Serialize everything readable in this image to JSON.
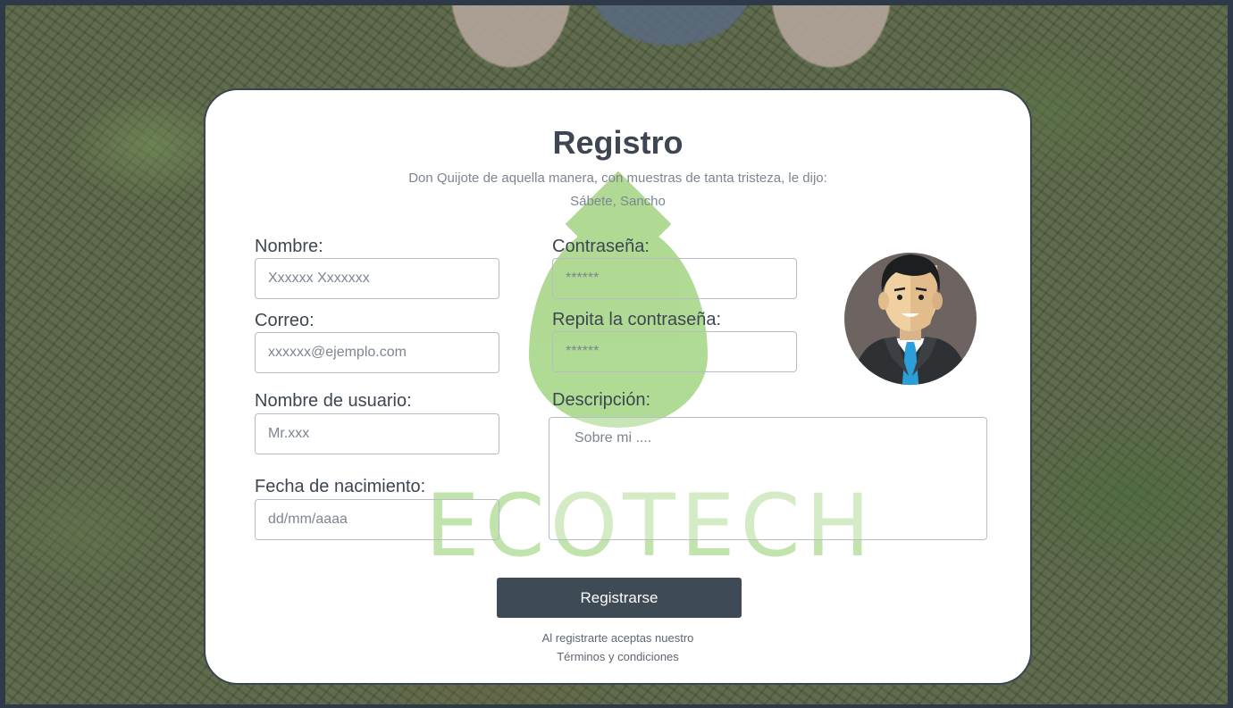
{
  "form": {
    "title": "Registro",
    "subtitle_line1": "Don Quijote de aquella manera, con muestras de tanta tristeza, le dijo:",
    "subtitle_line2": "Sábete, Sancho",
    "fields": {
      "nombre": {
        "label": "Nombre:",
        "placeholder": "Xxxxxx Xxxxxxx"
      },
      "correo": {
        "label": "Correo:",
        "placeholder": "xxxxxx@ejemplo.com"
      },
      "usuario": {
        "label": "Nombre de usuario:",
        "placeholder": "Mr.xxx"
      },
      "nacimiento": {
        "label": "Fecha de nacimiento:",
        "placeholder": "dd/mm/aaaa"
      },
      "contrasena": {
        "label": "Contraseña:",
        "placeholder": "******"
      },
      "repetir": {
        "label": "Repita la contraseña:",
        "placeholder": "******"
      },
      "descripcion": {
        "label": "Descripción:",
        "placeholder": "Sobre mi ...."
      }
    },
    "submit_label": "Registrarse",
    "terms_line1": "Al registrarte aceptas nuestro",
    "terms_line2": "Términos y condiciones"
  },
  "watermark": {
    "text": "ECOTECH"
  },
  "colors": {
    "accent_button": "#3f4a57",
    "text_primary": "#3d4652",
    "text_muted": "#7d8591",
    "logo_green": "#7cc34e"
  }
}
